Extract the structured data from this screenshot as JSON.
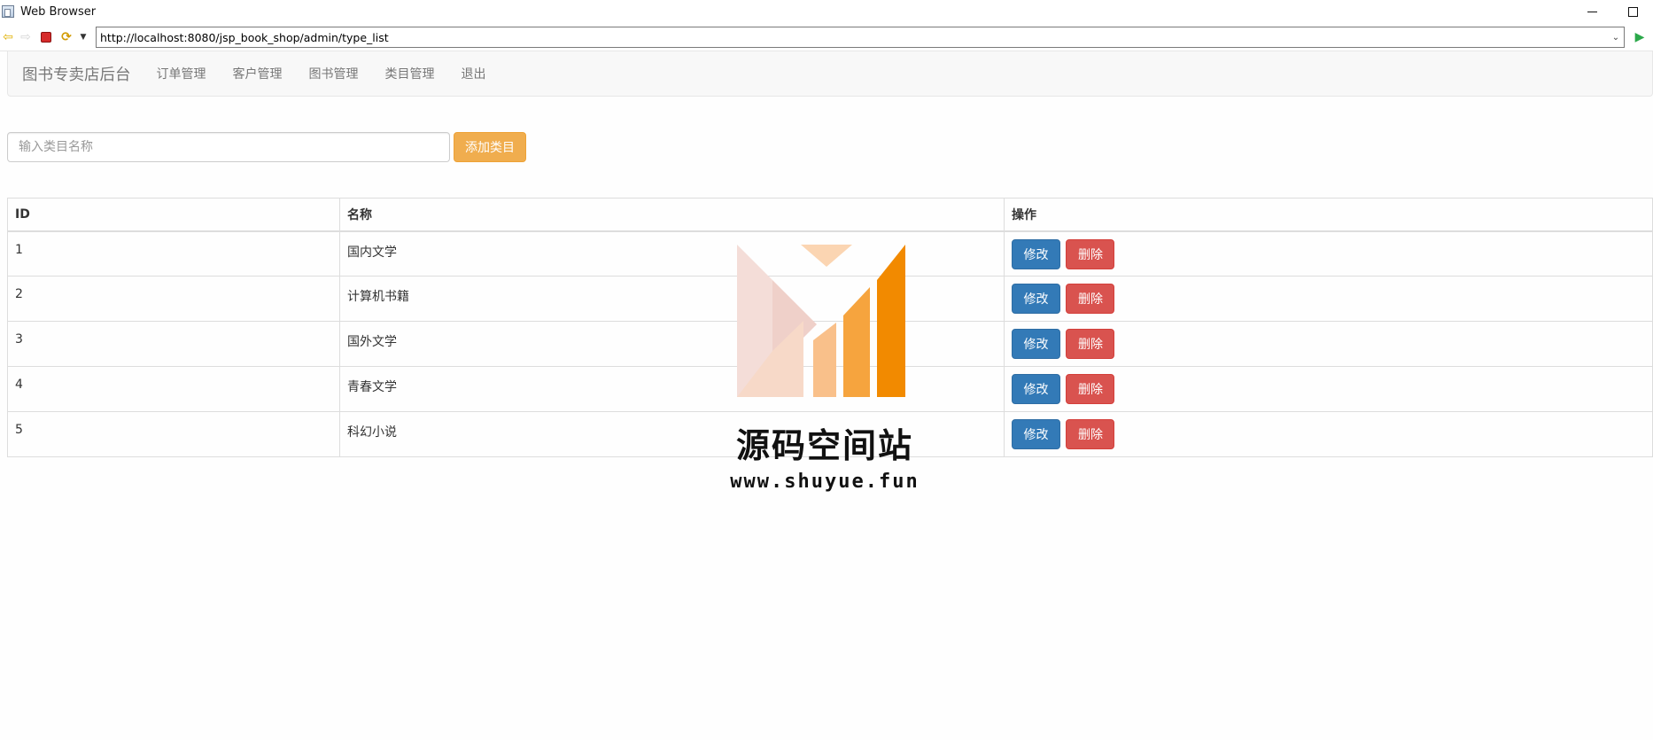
{
  "window": {
    "title": "Web Browser"
  },
  "browser": {
    "url": "http://localhost:8080/jsp_book_shop/admin/type_list"
  },
  "navbar": {
    "brand": "图书专卖店后台",
    "links": [
      "订单管理",
      "客户管理",
      "图书管理",
      "类目管理",
      "退出"
    ]
  },
  "form": {
    "placeholder": "输入类目名称",
    "add_label": "添加类目"
  },
  "table": {
    "headers": [
      "ID",
      "名称",
      "操作"
    ],
    "rows": [
      {
        "id": "1",
        "name": "国内文学"
      },
      {
        "id": "2",
        "name": "计算机书籍"
      },
      {
        "id": "3",
        "name": "国外文学"
      },
      {
        "id": "4",
        "name": "青春文学"
      },
      {
        "id": "5",
        "name": "科幻小说"
      }
    ],
    "edit_label": "修改",
    "delete_label": "删除"
  },
  "watermark": {
    "title": "源码空间站",
    "url": "www.shuyue.fun"
  },
  "colors": {
    "edit_button": "#337ab7",
    "delete_button": "#d9534f",
    "add_button": "#f0ad4e",
    "watermark_orange": "#f28a00"
  }
}
